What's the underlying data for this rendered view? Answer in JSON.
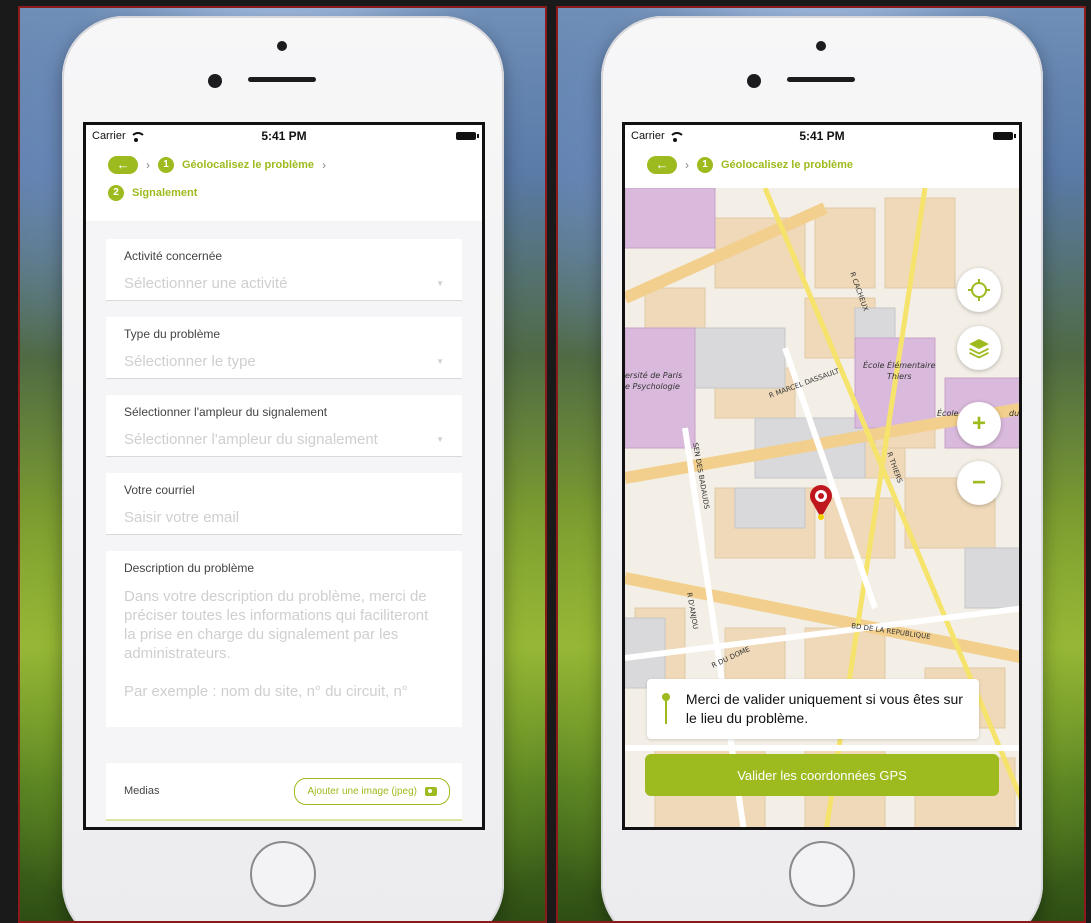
{
  "left_screen": {
    "status": {
      "carrier": "Carrier",
      "time": "5:41 PM"
    },
    "breadcrumb": {
      "back": "←",
      "step1_num": "1",
      "step1_label": "Géolocalisez le problème",
      "step2_num": "2",
      "step2_label": "Signalement"
    },
    "form": {
      "activity": {
        "label": "Activité concernée",
        "placeholder": "Sélectionner une activité"
      },
      "type": {
        "label": "Type du problème",
        "placeholder": "Sélectionner le type"
      },
      "scope": {
        "label": "Sélectionner l'ampleur du signalement",
        "placeholder": "Sélectionner l'ampleur du signalement"
      },
      "email": {
        "label": "Votre courriel",
        "placeholder": "Saisir votre email"
      },
      "description": {
        "label": "Description du problème",
        "placeholder_p1": "Dans votre description du problème, merci de préciser toutes les informations qui faciliteront la prise en charge du signalement par les administrateurs.",
        "placeholder_p2": "Par exemple : nom du site, n° du circuit, n°"
      }
    },
    "media": {
      "label": "Medias",
      "button": "Ajouter une image (jpeg)"
    }
  },
  "right_screen": {
    "status": {
      "carrier": "Carrier",
      "time": "5:41 PM"
    },
    "breadcrumb": {
      "back": "←",
      "step1_num": "1",
      "step1_label": "Géolocalisez le problème"
    },
    "map_labels": {
      "street_cacheux": "R CACHEUX",
      "univ_1": "ersité de Paris",
      "univ_2": "e Psychologie",
      "street_dassault": "R MARCEL DASSAULT",
      "school_1": "École Élémentaire",
      "school_2": "Thiers",
      "school_3": "École",
      "school_3b": "du",
      "street_thiers": "R THIERS",
      "street_badauds": "SEN DES BADAUDS",
      "street_anjou": "R D'ANJOU",
      "street_dome": "R DU DOME",
      "street_republique": "BD DE LA REPUBLIQUE"
    },
    "map_controls": {
      "locate": "⌖",
      "layers": "layers",
      "zoom_in": "+",
      "zoom_out": "−"
    },
    "notice": "Merci de valider uniquement si vous êtes sur le lieu du problème.",
    "gps_button": "Valider les coordonnées GPS"
  },
  "colors": {
    "accent": "#9dbb1e",
    "frame_border": "#8b1a1a"
  }
}
